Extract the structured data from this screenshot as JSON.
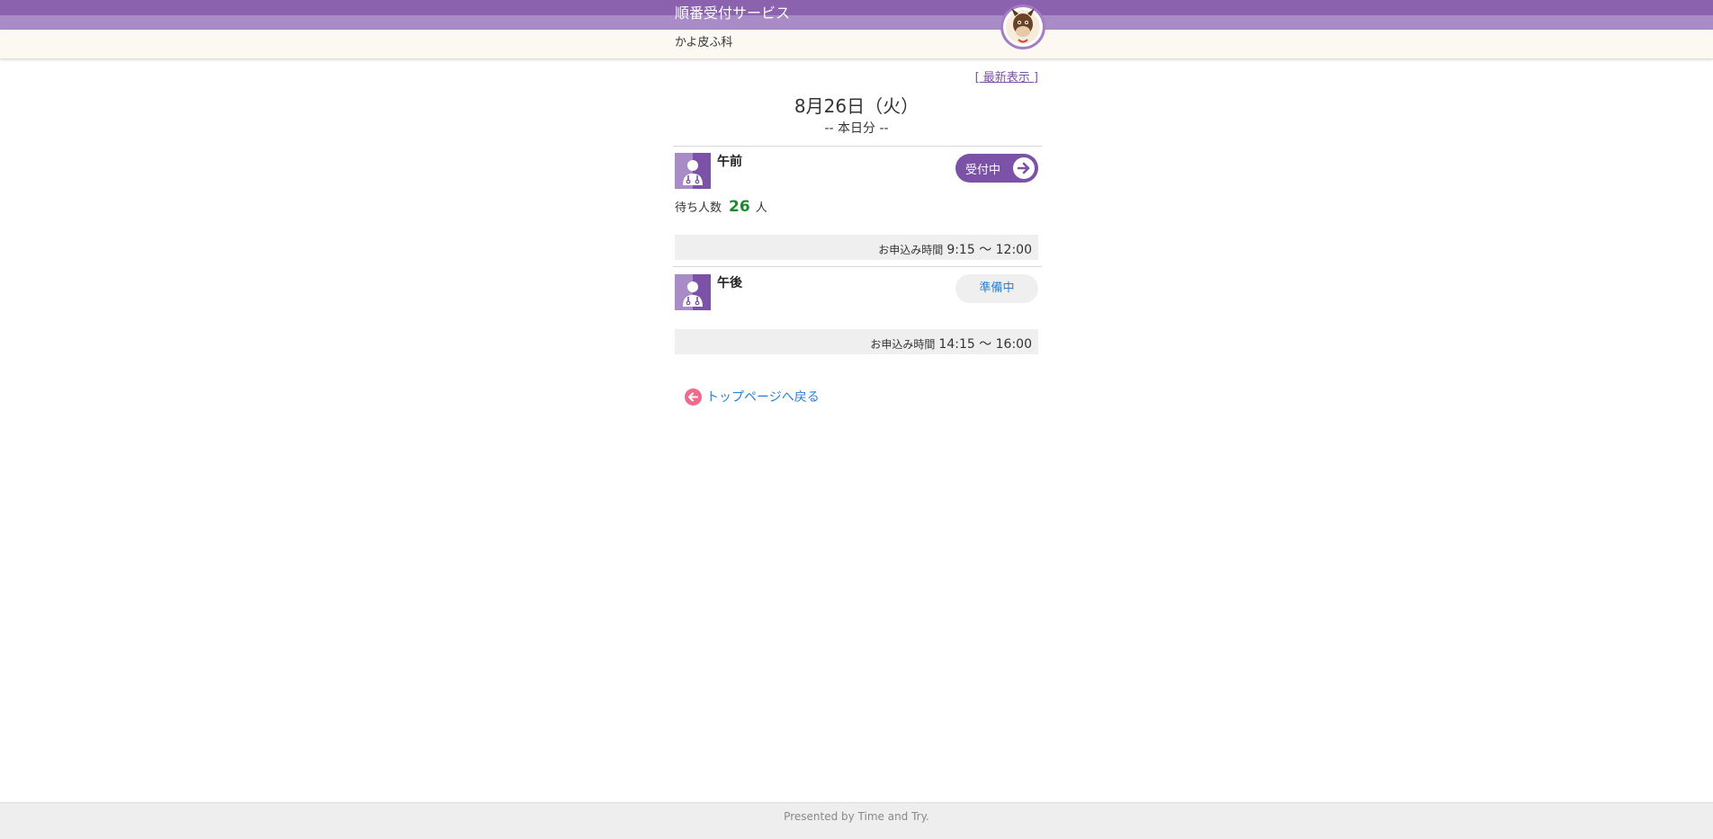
{
  "header": {
    "service_title": "順番受付サービス",
    "clinic_name": "かよ皮ふ科"
  },
  "refresh": {
    "bracket_open": "[",
    "label": " 最新表示 ",
    "bracket_close": "]"
  },
  "date": {
    "main": "8月26日（火）",
    "sub": "-- 本日分 --"
  },
  "sessions": [
    {
      "name": "午前",
      "status": "受付中",
      "wait_label": "待ち人数",
      "wait_count": "26",
      "wait_unit": "人",
      "time_label": "お申込み時間",
      "time_range": "9:15 〜 12:00"
    },
    {
      "name": "午後",
      "status": "準備中",
      "time_label": "お申込み時間",
      "time_range": "14:15 〜 16:00"
    }
  ],
  "back_link": "トップページへ戻る",
  "footer": "Presented by Time and Try.",
  "colors": {
    "brand_purple": "#8a62ad",
    "accent_purple": "#7b52a8",
    "wait_green": "#1a8a2a",
    "link_blue": "#2a7fd4",
    "back_pink": "#f06a8b"
  },
  "icons": {
    "mascot": "mascot-avatar-icon",
    "doctor": "doctor-icon",
    "arrow_right": "arrow-right-circle-icon",
    "arrow_left": "arrow-left-circle-icon"
  }
}
